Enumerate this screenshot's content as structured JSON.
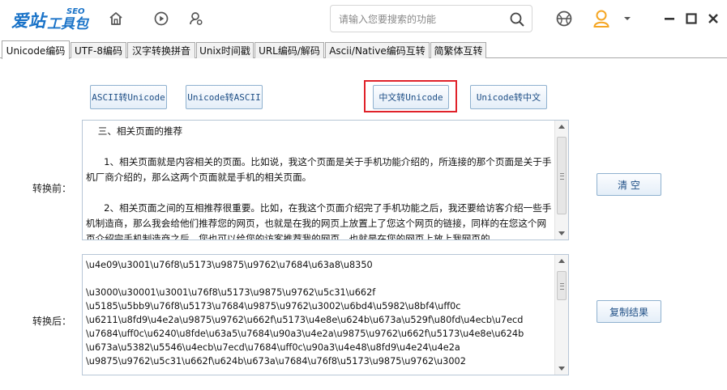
{
  "app": {
    "logo_text": "爱站工具包",
    "logo_sup": "SEO"
  },
  "search": {
    "placeholder": "请输入您要搜索的功能"
  },
  "tabs": [
    {
      "label": "Unicode编码"
    },
    {
      "label": "UTF-8编码"
    },
    {
      "label": "汉字转换拼音"
    },
    {
      "label": "Unix时间戳"
    },
    {
      "label": "URL编码/解码"
    },
    {
      "label": "Ascii/Native编码互转"
    },
    {
      "label": "简繁体互转"
    }
  ],
  "convert_buttons": {
    "ascii_to_unicode": "ASCII转Unicode",
    "unicode_to_ascii": "Unicode转ASCII",
    "chinese_to_unicode": "中文转Unicode",
    "unicode_to_chinese": "Unicode转中文"
  },
  "input": {
    "label": "转换前：",
    "text": "    三、相关页面的推荐\n\n      1、相关页面就是内容相关的页面。比如说，我这个页面是关于手机功能介绍的，所连接的那个页面是关于手机厂商介绍的，那么这两个页面就是手机的相关页面。\n\n      2、相关页面之间的互相推荐很重要。比如，在我这个页面介绍完了手机功能之后，我还要给访客介绍一些手机制造商，那么我会给他们推荐您的网页，也就是在我的网页上放置上了您这个网页的链接，同样的在您这个网页介绍完手机制造商之后，您也可以给您的访客推荐我的网页，也就是在您的网页上放上我网页的"
  },
  "output": {
    "label": "转换后：",
    "text": "\\u4e09\\u3001\\u76f8\\u5173\\u9875\\u9762\\u7684\\u63a8\\u8350\n\n\\u3000\\u30001\\u3001\\u76f8\\u5173\\u9875\\u9762\\u5c31\\u662f\n\\u5185\\u5bb9\\u76f8\\u5173\\u7684\\u9875\\u9762\\u3002\\u6bd4\\u5982\\u8bf4\\uff0c\n\\u6211\\u8fd9\\u4e2a\\u9875\\u9762\\u662f\\u5173\\u4e8e\\u624b\\u673a\\u529f\\u80fd\\u4ecb\\u7ecd\n\\u7684\\uff0c\\u6240\\u8fde\\u63a5\\u7684\\u90a3\\u4e2a\\u9875\\u9762\\u662f\\u5173\\u4e8e\\u624b\n\\u673a\\u5382\\u5546\\u4ecb\\u7ecd\\u7684\\uff0c\\u90a3\\u4e48\\u8fd9\\u4e24\\u4e2a\n\\u9875\\u9762\\u5c31\\u662f\\u624b\\u673a\\u7684\\u76f8\\u5173\\u9875\\u9762\\u3002"
  },
  "actions": {
    "clear": "清  空",
    "copy": "复制结果"
  },
  "colors": {
    "accent": "#1a73c8",
    "highlight": "#e0222a",
    "avatar": "#f5a623"
  }
}
